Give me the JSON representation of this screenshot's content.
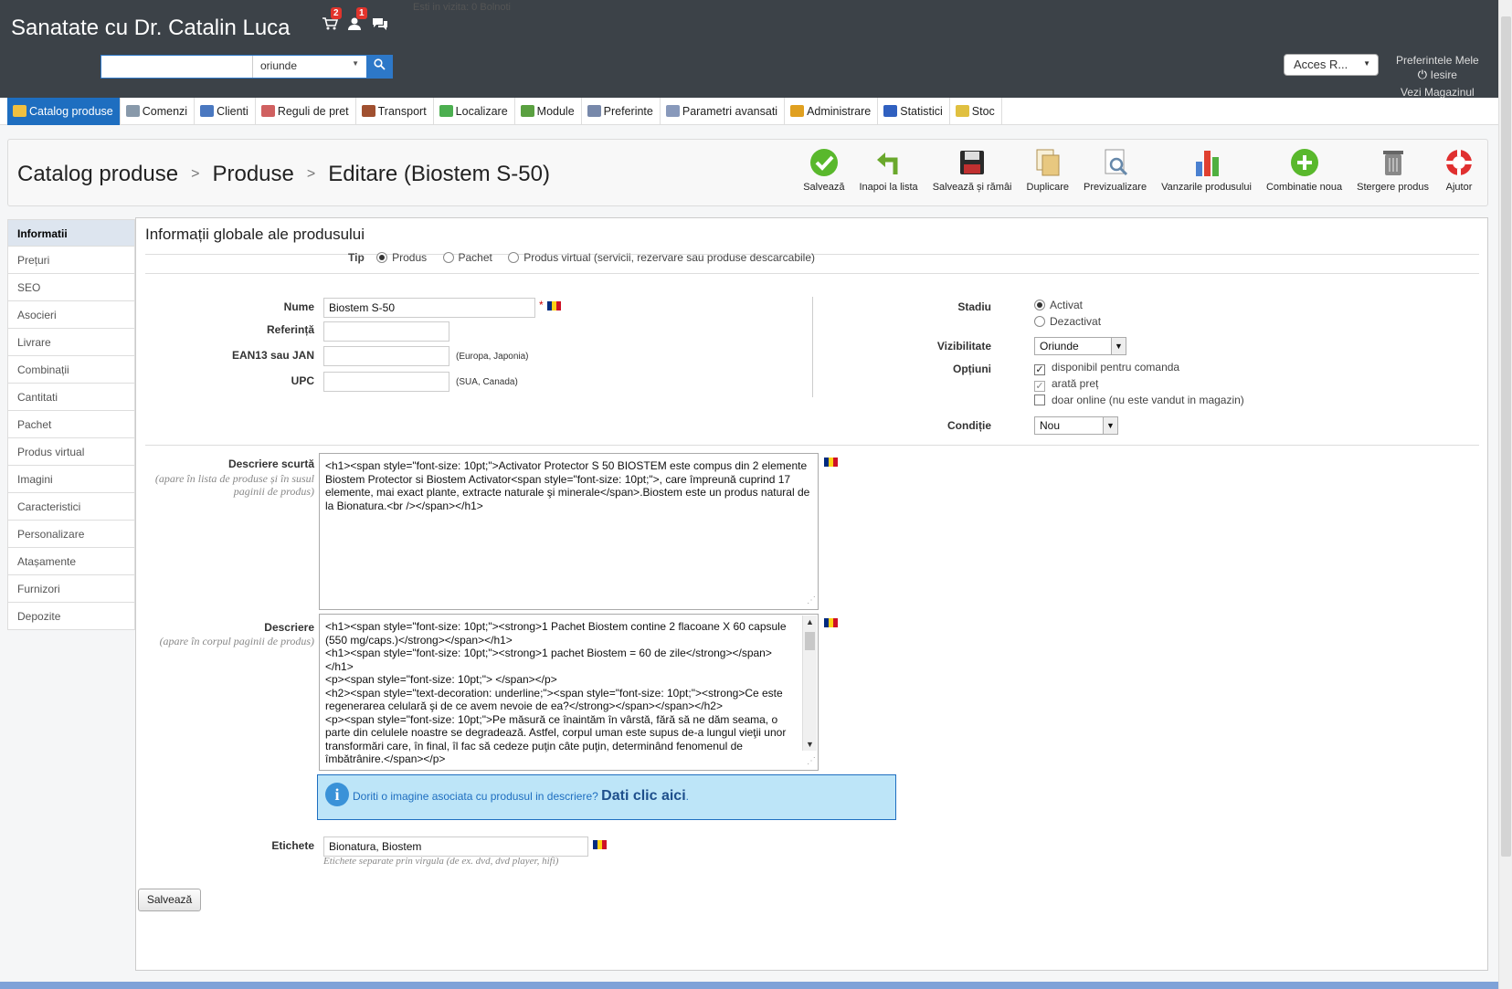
{
  "header": {
    "shop_name": "Sanatate cu Dr. Catalin Luca",
    "notif_orders": "2",
    "notif_customers": "1",
    "ghost_text": "Esti in vizita: 0 Bolnoti",
    "search_placeholder": "",
    "search_scope": "oriunde",
    "quick_access": "Acces R...",
    "my_preferences": "Preferintele Mele",
    "logout": "Iesire",
    "view_shop": "Vezi Magazinul"
  },
  "menu": [
    {
      "label": "Catalog produse",
      "color": "#f0c040"
    },
    {
      "label": "Comenzi",
      "color": "#8899aa"
    },
    {
      "label": "Clienti",
      "color": "#4a78c0"
    },
    {
      "label": "Reguli de pret",
      "color": "#d06060"
    },
    {
      "label": "Transport",
      "color": "#a05030"
    },
    {
      "label": "Localizare",
      "color": "#4caf50"
    },
    {
      "label": "Module",
      "color": "#5aa040"
    },
    {
      "label": "Preferinte",
      "color": "#7788aa"
    },
    {
      "label": "Parametri avansati",
      "color": "#8899bb"
    },
    {
      "label": "Administrare",
      "color": "#e0a020"
    },
    {
      "label": "Statistici",
      "color": "#3060c0"
    },
    {
      "label": "Stoc",
      "color": "#e0c040"
    }
  ],
  "breadcrumb": {
    "level1": "Catalog produse",
    "level2": "Produse",
    "level3": "Editare (Biostem S-50)"
  },
  "toolbar": [
    {
      "label": "Salvează",
      "icon": "check-icon",
      "color": "#59b82c"
    },
    {
      "label": "Inapoi la lista",
      "icon": "back-arrow-icon",
      "color": "#6aa82c"
    },
    {
      "label": "Salvează și rămâi",
      "icon": "floppy-disk-icon",
      "color": "#2a2a2a"
    },
    {
      "label": "Duplicare",
      "icon": "duplicate-icon",
      "color": "#e8c880"
    },
    {
      "label": "Previzualizare",
      "icon": "preview-icon",
      "color": "#6688aa"
    },
    {
      "label": "Vanzarile produsului",
      "icon": "sales-chart-icon",
      "color": "#e04030"
    },
    {
      "label": "Combinatie noua",
      "icon": "plus-icon",
      "color": "#59b82c"
    },
    {
      "label": "Stergere produs",
      "icon": "trash-icon",
      "color": "#888888"
    },
    {
      "label": "Ajutor",
      "icon": "help-lifebuoy-icon",
      "color": "#e03030"
    }
  ],
  "sidebar": [
    "Informatii",
    "Prețuri",
    "SEO",
    "Asocieri",
    "Livrare",
    "Combinații",
    "Cantitati",
    "Pachet",
    "Produs virtual",
    "Imagini",
    "Caracteristici",
    "Personalizare",
    "Atașamente",
    "Furnizori",
    "Depozite"
  ],
  "form": {
    "section_title": "Informații globale ale produsului",
    "type_label": "Tip",
    "type_options": [
      "Produs",
      "Pachet",
      "Produs virtual (servicii, rezervare sau produse descarcabile)"
    ],
    "name_label": "Nume",
    "name_value": "Biostem S-50",
    "required_mark": "*",
    "reference_label": "Referință",
    "ean_label": "EAN13 sau JAN",
    "ean_hint": "(Europa, Japonia)",
    "upc_label": "UPC",
    "upc_hint": "(SUA, Canada)",
    "status_label": "Stadiu",
    "status_on": "Activat",
    "status_off": "Dezactivat",
    "visibility_label": "Vizibilitate",
    "visibility_value": "Oriunde",
    "options_label": "Opțiuni",
    "option_available": "disponibil pentru comanda",
    "option_show_price": "arată preț",
    "option_online_only": "doar online (nu este vandut in magazin)",
    "condition_label": "Condiție",
    "condition_value": "Nou",
    "short_desc_label": "Descriere scurtă",
    "short_desc_sub": "(apare în lista de produse și în susul paginii de produs)",
    "short_desc_value": "<h1><span style=\"font-size: 10pt;\">Activator Protector S 50 BIOSTEM este compus din 2 elemente Biostem Protector si Biostem Activator<span style=\"font-size: 10pt;\">, care împreună cuprind 17 elemente, mai exact plante, extracte naturale şi minerale</span>.Biostem este un produs natural de la Bionatura.<br /></span></h1>",
    "desc_label": "Descriere",
    "desc_sub": "(apare în corpul paginii de produs)",
    "desc_value": "<h1><span style=\"font-size: 10pt;\"><strong>1 Pachet Biostem contine 2 flacoane X 60 capsule (550 mg/caps.)</strong></span></h1>\n<h1><span style=\"font-size: 10pt;\"><strong>1 pachet Biostem = 60 de zile</strong></span></h1>\n<p><span style=\"font-size: 10pt;\"> </span></p>\n<h2><span style=\"text-decoration: underline;\"><span style=\"font-size: 10pt;\"><strong>Ce este regenerarea celulară şi de ce avem nevoie de ea?</strong></span></span></h2>\n<p><span style=\"font-size: 10pt;\">Pe măsură ce înaintăm în vârstă, fără să ne dăm seama, o parte din celulele noastre se degradează. Astfel, corpul uman este supus de-a lungul vieţii unor transformări care, în final, îl fac să cedeze puţin câte puţin, determinând fenomenul de îmbătrânire.</span></p>",
    "info_text": "Doriti o imagine asociata cu produsul in descriere?",
    "info_link": "Dati clic aici",
    "info_dot": ".",
    "tags_label": "Etichete",
    "tags_value": "Bionatura, Biostem",
    "tags_hint": "Etichete separate prin virgula (de ex. dvd, dvd player, hifi)",
    "save_button": "Salvează"
  }
}
